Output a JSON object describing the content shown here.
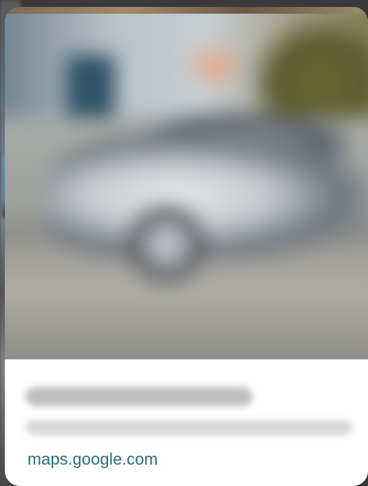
{
  "card": {
    "title": "",
    "subtitle": "",
    "link_text": "maps.google.com"
  },
  "colors": {
    "link": "#2a6f80",
    "card_background": "#ffffff",
    "page_background": "#3a3a3c"
  }
}
